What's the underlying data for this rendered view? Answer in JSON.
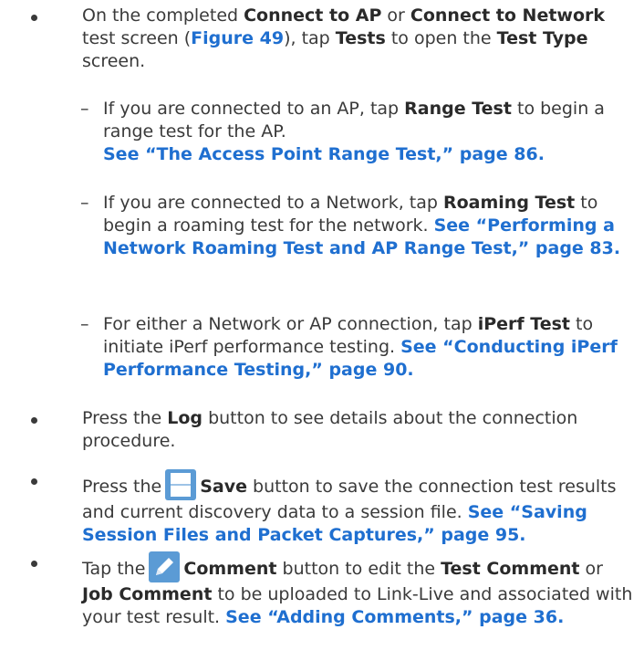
{
  "b1": {
    "t1": "On the completed ",
    "k1": "Connect to AP",
    "t2": " or ",
    "k2": "Connect to Network",
    "t3": " test screen (",
    "fig": "Figure 49",
    "t4": "), tap ",
    "k3": "Tests",
    "t5": " to open the ",
    "k4": "Test Type",
    "t6": " screen."
  },
  "s1": {
    "t1": "If you are connected to an AP, tap ",
    "k1": "Range Test",
    "t2": " to begin a range test for the AP.",
    "link": "See “The Access Point Range Test,” page 86."
  },
  "s2": {
    "t1": "If you are connected to a Network, tap ",
    "k1": "Roaming Test",
    "t2": " to begin a roaming test for the network. ",
    "link": "See “Performing a Network Roaming Test and AP Range Test,” page 83."
  },
  "s3": {
    "t1": "For either a Network or AP connection, tap ",
    "k1": "iPerf Test",
    "t2": " to initiate iPerf performance testing. ",
    "link": "See “Conducting iPerf Performance Testing,” page 90."
  },
  "b2": {
    "t1": "Press the ",
    "k1": "Log",
    "t2": " button to see details about the connection procedure."
  },
  "b3": {
    "t1": "Press the",
    "k1": "Save",
    "t2": " button to save the connection test results and current discovery data to a session file. ",
    "link": "See “Saving Session Files and Packet Captures,” page 95."
  },
  "b4": {
    "t1": "Tap the",
    "k1": "Comment",
    "t2": " button to edit the ",
    "k2": "Test Comment",
    "t3": " or ",
    "k3": "Job Comment",
    "t4": " to be uploaded to Link-Live and associated with your test result. ",
    "link": "See “Adding Comments,” page 36."
  },
  "dash": "–",
  "icons": {
    "save": "save-icon",
    "comment": "pencil-icon"
  },
  "colors": {
    "text": "#3a3a3a",
    "link": "#1f6fd0",
    "icon_blue": "#5b9bd5"
  }
}
